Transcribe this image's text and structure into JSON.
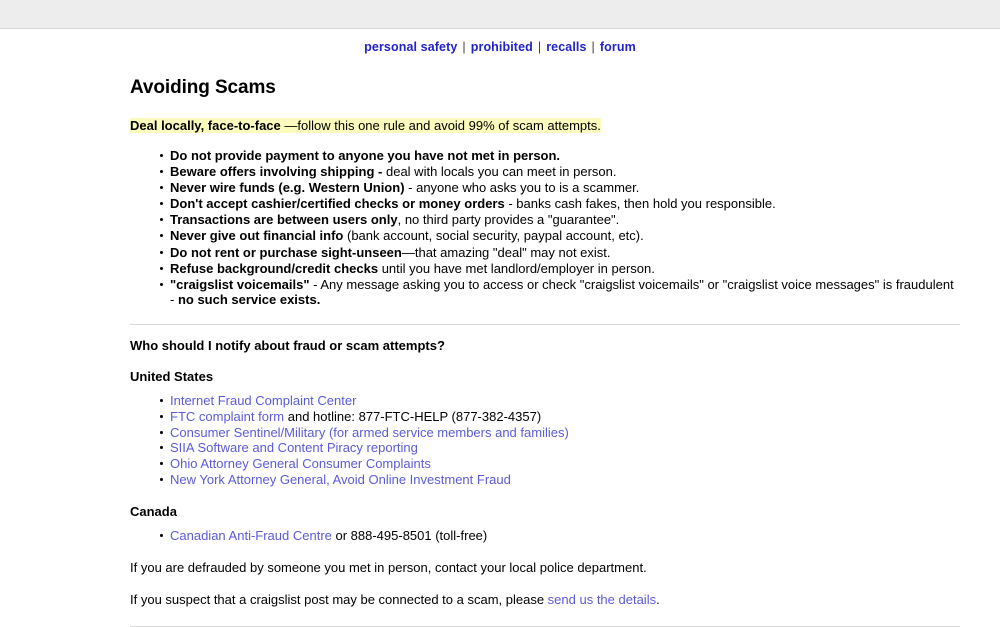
{
  "nav": {
    "separator": "|",
    "items": [
      {
        "label": "personal safety"
      },
      {
        "label": "prohibited"
      },
      {
        "label": "recalls"
      },
      {
        "label": "forum"
      }
    ]
  },
  "main": {
    "title": "Avoiding Scams",
    "highlight": {
      "bold": "Deal locally, face-to-face",
      "rest": " —follow this one rule and avoid 99% of scam attempts."
    },
    "rules": [
      {
        "bold": "Do not provide payment to anyone you have not met in person.",
        "rest": ""
      },
      {
        "bold": "Beware offers involving shipping -",
        "rest": " deal with locals you can meet in person."
      },
      {
        "bold": "Never wire funds (e.g. Western Union)",
        "rest": " - anyone who asks you to is a scammer."
      },
      {
        "bold": "Don't accept cashier/certified checks or money orders",
        "rest": " - banks cash fakes, then hold you responsible."
      },
      {
        "bold": "Transactions are between users only",
        "rest": ", no third party provides a \"guarantee\"."
      },
      {
        "bold": "Never give out financial info",
        "rest": " (bank account, social security, paypal account, etc)."
      },
      {
        "bold": "Do not rent or purchase sight-unseen",
        "rest": "—that amazing \"deal\" may not exist."
      },
      {
        "bold": "Refuse background/credit checks",
        "rest": " until you have met landlord/employer in person."
      },
      {
        "bold": "\"craigslist voicemails\"",
        "rest": " - Any message asking you to access or check \"craigslist voicemails\" or \"craigslist voice messages\" is fraudulent - ",
        "bold_tail": "no such service exists."
      }
    ],
    "question_heading": "Who should I notify about fraud or scam attempts?",
    "sections": [
      {
        "heading": "United States",
        "links": [
          {
            "link": "Internet Fraud Complaint Center",
            "text": ""
          },
          {
            "link": "FTC complaint form",
            "text": " and hotline: 877-FTC-HELP (877-382-4357)"
          },
          {
            "link": "Consumer Sentinel/Military (for armed service members and families)",
            "text": ""
          },
          {
            "link": "SIIA Software and Content Piracy reporting",
            "text": ""
          },
          {
            "link": "Ohio Attorney General Consumer Complaints",
            "text": ""
          },
          {
            "link": "New York Attorney General, Avoid Online Investment Fraud",
            "text": ""
          }
        ]
      },
      {
        "heading": "Canada",
        "links": [
          {
            "link": "Canadian Anti-Fraud Centre",
            "text": " or 888-495-8501 (toll-free)"
          }
        ]
      }
    ],
    "paragraphs": [
      {
        "before": "If you are defrauded by someone you met in person, contact your local police department.",
        "link": "",
        "after": ""
      },
      {
        "before": "If you suspect that a craigslist post may be connected to a scam, please ",
        "link": "send us the details",
        "after": "."
      }
    ]
  },
  "colors": {
    "nav_link": "#2222cc",
    "body_link": "#5b5bdb",
    "highlight": "#fbfbbd",
    "topbar": "#ededed",
    "rule": "#d9d9d9"
  }
}
